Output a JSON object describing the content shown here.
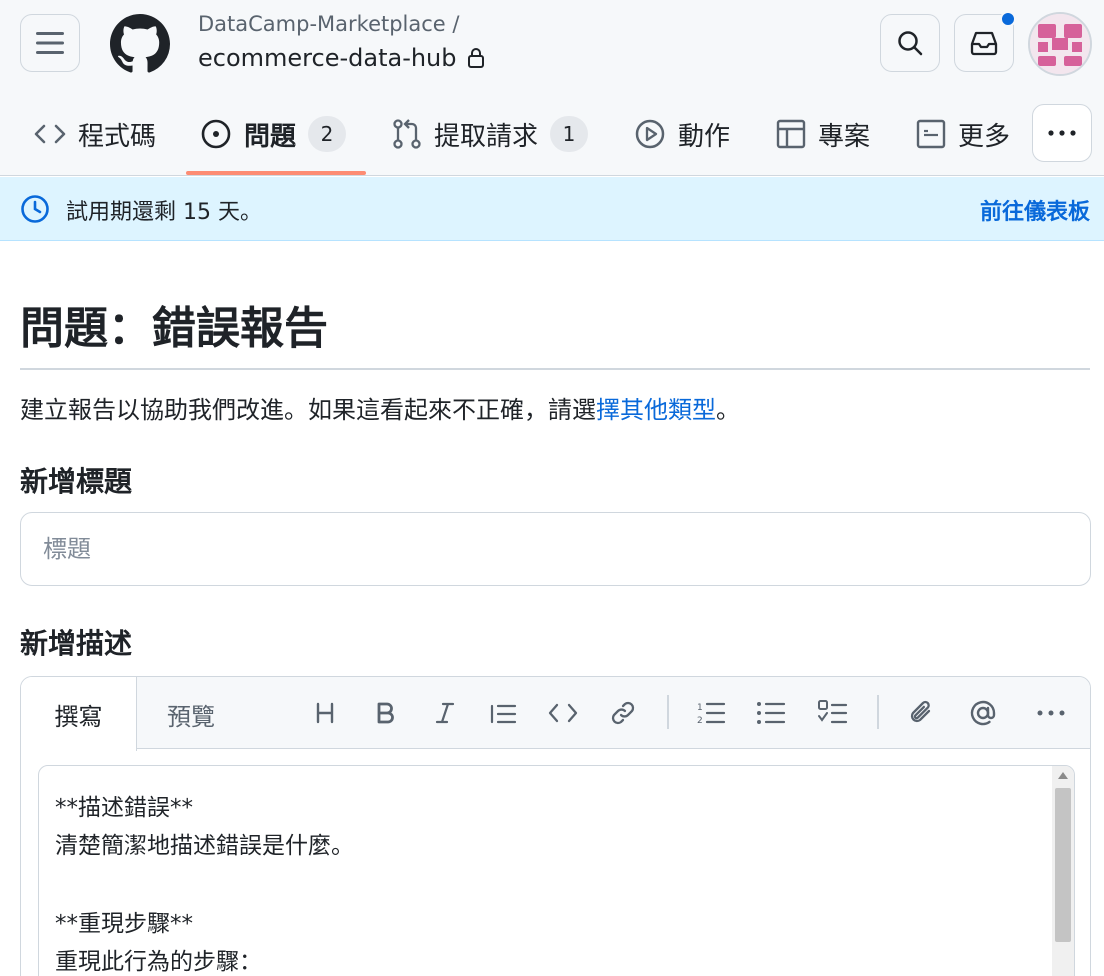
{
  "header": {
    "owner": "DataCamp-Marketplace /",
    "repo_name": "ecommerce-data-hub"
  },
  "tabs": [
    {
      "label": "程式碼"
    },
    {
      "label": "問題",
      "count": "2"
    },
    {
      "label": "提取請求",
      "count": "1"
    },
    {
      "label": "動作"
    },
    {
      "label": "專案"
    },
    {
      "label": "更多"
    }
  ],
  "banner": {
    "text": "試用期還剩 15 天。",
    "link": "前往儀表板"
  },
  "form": {
    "title": "問題：錯誤報告",
    "description_prefix": "建立報告以協助我們改進。如果這看起來不正確，請選",
    "description_link": "擇其他類型",
    "description_suffix": "。",
    "title_label": "新增標題",
    "title_placeholder": "標題",
    "title_value": "",
    "desc_label": "新增描述"
  },
  "editor": {
    "write_tab": "撰寫",
    "preview_tab": "預覽",
    "lines": [
      "**描述錯誤**",
      "清楚簡潔地描述錯誤是什麼。",
      "",
      "**重現步驟**",
      "重現此行為的步驟："
    ]
  },
  "colors": {
    "accent": "#0969da",
    "tab_underline": "#fd8c73",
    "banner_bg": "#ddf4ff",
    "notification_dot": "#0969da"
  }
}
